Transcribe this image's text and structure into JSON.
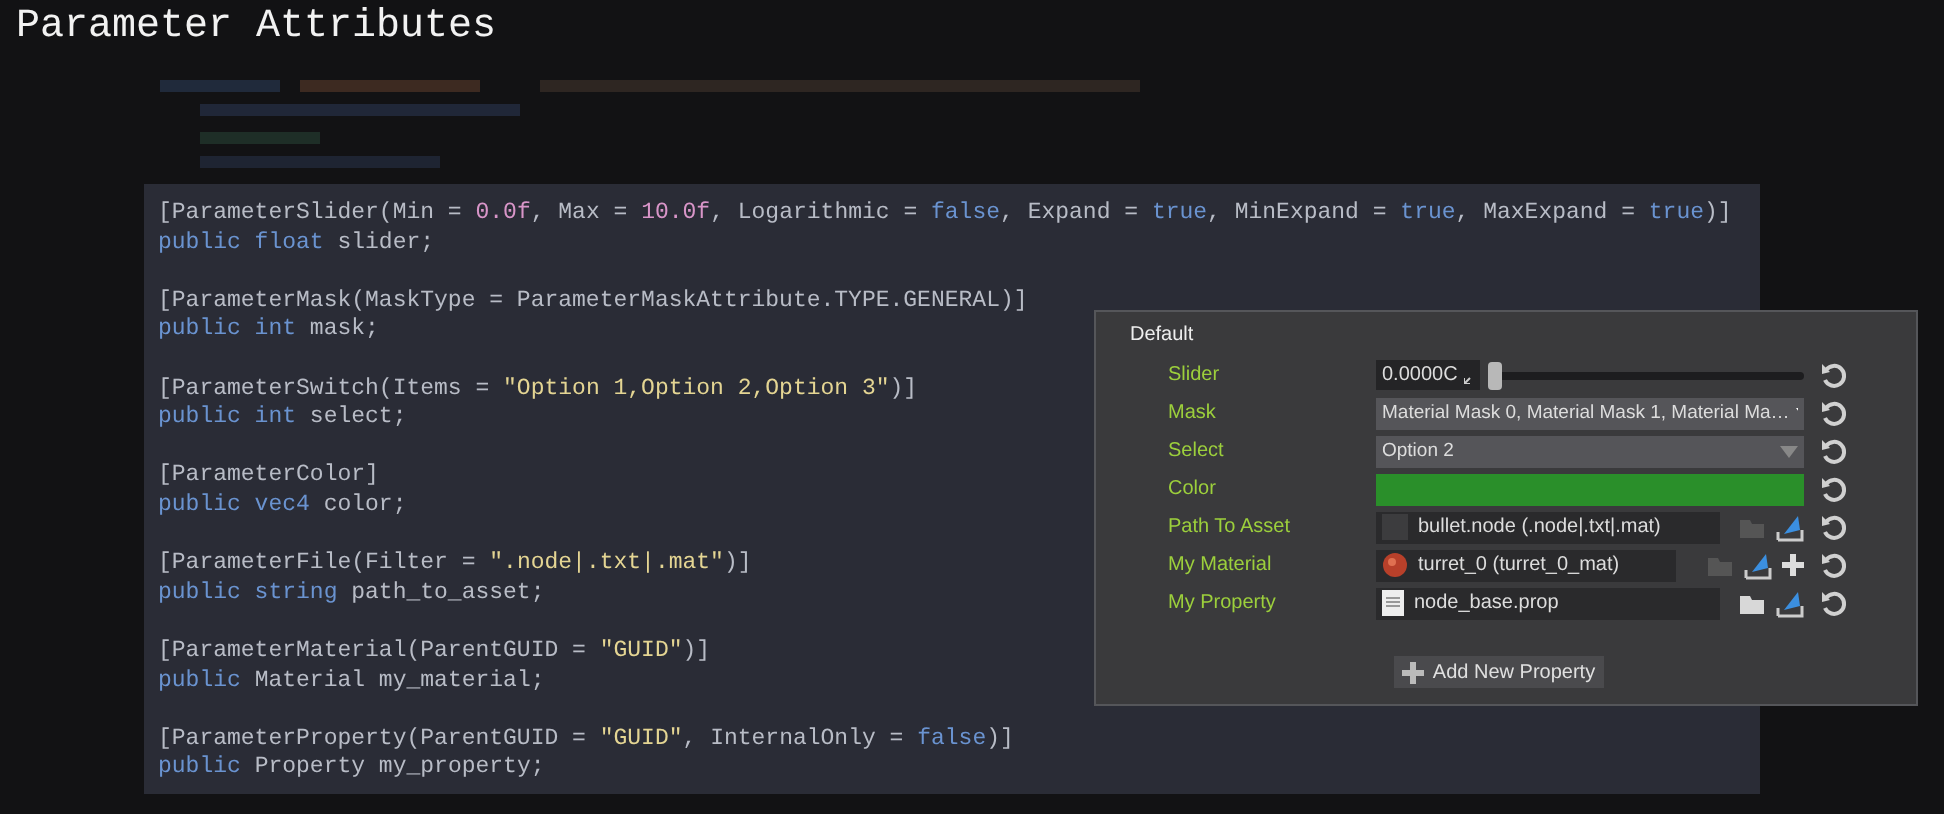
{
  "title": "Parameter Attributes",
  "code_blocks": [
    {
      "attribute": [
        {
          "text": "[ParameterSlider(Min = ",
          "kind": "plain"
        },
        {
          "text": "0.0f",
          "kind": "number"
        },
        {
          "text": ", Max = ",
          "kind": "plain"
        },
        {
          "text": "10.0f",
          "kind": "number"
        },
        {
          "text": ", Logarithmic = ",
          "kind": "plain"
        },
        {
          "text": "false",
          "kind": "keyword"
        },
        {
          "text": ", Expand = ",
          "kind": "plain"
        },
        {
          "text": "true",
          "kind": "keyword"
        },
        {
          "text": ", MinExpand = ",
          "kind": "plain"
        },
        {
          "text": "true",
          "kind": "keyword"
        },
        {
          "text": ", MaxExpand = ",
          "kind": "plain"
        },
        {
          "text": "true",
          "kind": "keyword"
        },
        {
          "text": ")]",
          "kind": "plain"
        }
      ],
      "declaration": [
        {
          "text": "public float",
          "kind": "keyword"
        },
        {
          "text": " slider;",
          "kind": "plain"
        }
      ]
    },
    {
      "attribute": [
        {
          "text": "[ParameterMask(MaskType = ParameterMaskAttribute.TYPE.GENERAL)]",
          "kind": "plain"
        }
      ],
      "declaration": [
        {
          "text": "public int",
          "kind": "keyword"
        },
        {
          "text": " mask;",
          "kind": "plain"
        }
      ]
    },
    {
      "attribute": [
        {
          "text": "[ParameterSwitch(Items = ",
          "kind": "plain"
        },
        {
          "text": "\"Option 1,Option 2,Option 3\"",
          "kind": "string"
        },
        {
          "text": ")]",
          "kind": "plain"
        }
      ],
      "declaration": [
        {
          "text": "public int",
          "kind": "keyword"
        },
        {
          "text": " select;",
          "kind": "plain"
        }
      ]
    },
    {
      "attribute": [
        {
          "text": "[ParameterColor]",
          "kind": "plain"
        }
      ],
      "declaration": [
        {
          "text": "public vec4",
          "kind": "keyword"
        },
        {
          "text": " color;",
          "kind": "plain"
        }
      ]
    },
    {
      "attribute": [
        {
          "text": "[ParameterFile(Filter = ",
          "kind": "plain"
        },
        {
          "text": "\".node|.txt|.mat\"",
          "kind": "string"
        },
        {
          "text": ")]",
          "kind": "plain"
        }
      ],
      "declaration": [
        {
          "text": "public string",
          "kind": "keyword"
        },
        {
          "text": " path_to_asset;",
          "kind": "plain"
        }
      ]
    },
    {
      "attribute": [
        {
          "text": "[ParameterMaterial(ParentGUID = ",
          "kind": "plain"
        },
        {
          "text": "\"GUID\"",
          "kind": "string"
        },
        {
          "text": ")]",
          "kind": "plain"
        }
      ],
      "declaration": [
        {
          "text": "public",
          "kind": "keyword"
        },
        {
          "text": " Material my_material;",
          "kind": "plain"
        }
      ]
    },
    {
      "attribute": [
        {
          "text": "[ParameterProperty(ParentGUID = ",
          "kind": "plain"
        },
        {
          "text": "\"GUID\"",
          "kind": "string"
        },
        {
          "text": ", InternalOnly = ",
          "kind": "plain"
        },
        {
          "text": "false",
          "kind": "keyword"
        },
        {
          "text": ")]",
          "kind": "plain"
        }
      ],
      "declaration": [
        {
          "text": "public",
          "kind": "keyword"
        },
        {
          "text": " Property my_property;",
          "kind": "plain"
        }
      ]
    }
  ],
  "panel": {
    "group": "Default",
    "rows": [
      {
        "kind": "slider",
        "label": "Slider",
        "value": "0.0000C",
        "level": 0
      },
      {
        "kind": "dropdown",
        "label": "Mask",
        "value": "Material Mask 0, Material Mask 1, Material Ma…"
      },
      {
        "kind": "dropdown",
        "label": "Select",
        "value": "Option 2"
      },
      {
        "kind": "color",
        "label": "Color",
        "color": "#2a8f2a"
      },
      {
        "kind": "file",
        "label": "Path To Asset",
        "value": "bullet.node (.node|.txt|.mat)",
        "icon": {
          "kind": "blank"
        },
        "add": false
      },
      {
        "kind": "file",
        "label": "My Material",
        "value": "turret_0 (turret_0_mat)",
        "icon": {
          "kind": "material"
        },
        "add": true
      },
      {
        "kind": "file",
        "label": "My Property",
        "value": "node_base.prop",
        "icon": {
          "kind": "document"
        },
        "add": false
      }
    ],
    "add_button": "Add New Property"
  }
}
